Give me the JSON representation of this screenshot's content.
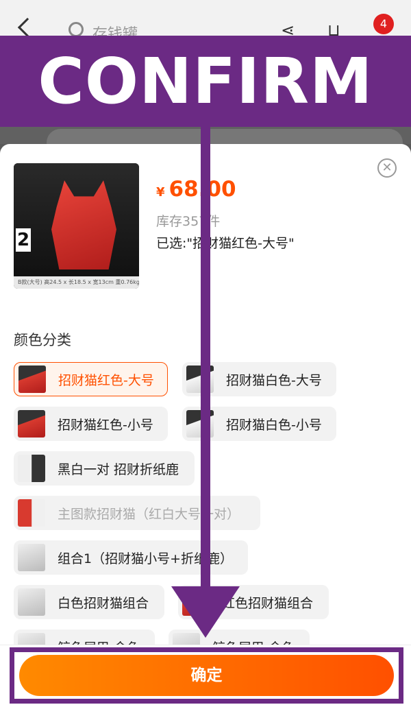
{
  "appbar": {
    "search_text": "存钱罐",
    "cart_badge": "4",
    "share_icon": "share-icon",
    "cart_icon": "cart-icon"
  },
  "banner": {
    "text": "CONFIRM"
  },
  "product": {
    "image_number": "2",
    "image_caption": "B款(大号)   高24.5 x 长18.5 x 宽13cm  重0.76kg",
    "currency": "¥",
    "price": "68.00",
    "stock": "库存357件",
    "selected": "已选:\"招财猫红色-大号\""
  },
  "sku": {
    "title": "颜色分类",
    "options": [
      {
        "label": "招财猫红色-大号",
        "state": "selected"
      },
      {
        "label": "招财猫白色-大号",
        "state": "normal"
      },
      {
        "label": "招财猫红色-小号",
        "state": "normal"
      },
      {
        "label": "招财猫白色-小号",
        "state": "normal"
      },
      {
        "label": "黑白一对 招财折纸鹿",
        "state": "normal"
      },
      {
        "label": "主图款招财猫（红白大号一对）",
        "state": "disabled"
      },
      {
        "label": "组合1（招财猫小号+折纸鹿）",
        "state": "normal"
      },
      {
        "label": "白色招财猫组合",
        "state": "normal"
      },
      {
        "label": "红色招财猫组合",
        "state": "normal"
      },
      {
        "label": "鲸鱼尾巴 金色",
        "state": "normal"
      },
      {
        "label": "鲸鱼尾巴 金色",
        "state": "normal"
      }
    ]
  },
  "confirm": {
    "label": "确定"
  },
  "colors": {
    "accent": "#ff5000",
    "annotation": "#6b2a84"
  }
}
